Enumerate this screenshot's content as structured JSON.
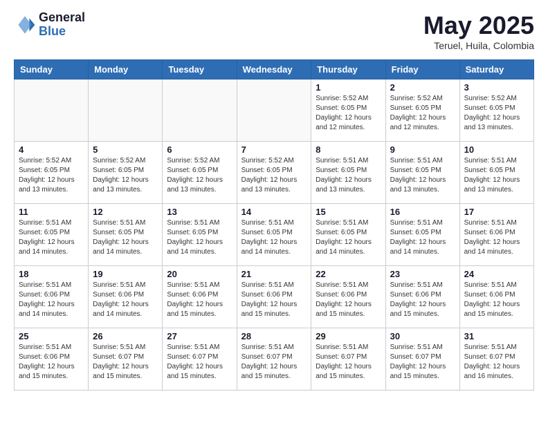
{
  "logo": {
    "general": "General",
    "blue": "Blue"
  },
  "header": {
    "month": "May 2025",
    "location": "Teruel, Huila, Colombia"
  },
  "weekdays": [
    "Sunday",
    "Monday",
    "Tuesday",
    "Wednesday",
    "Thursday",
    "Friday",
    "Saturday"
  ],
  "weeks": [
    [
      {
        "day": "",
        "info": ""
      },
      {
        "day": "",
        "info": ""
      },
      {
        "day": "",
        "info": ""
      },
      {
        "day": "",
        "info": ""
      },
      {
        "day": "1",
        "info": "Sunrise: 5:52 AM\nSunset: 6:05 PM\nDaylight: 12 hours\nand 12 minutes."
      },
      {
        "day": "2",
        "info": "Sunrise: 5:52 AM\nSunset: 6:05 PM\nDaylight: 12 hours\nand 12 minutes."
      },
      {
        "day": "3",
        "info": "Sunrise: 5:52 AM\nSunset: 6:05 PM\nDaylight: 12 hours\nand 13 minutes."
      }
    ],
    [
      {
        "day": "4",
        "info": "Sunrise: 5:52 AM\nSunset: 6:05 PM\nDaylight: 12 hours\nand 13 minutes."
      },
      {
        "day": "5",
        "info": "Sunrise: 5:52 AM\nSunset: 6:05 PM\nDaylight: 12 hours\nand 13 minutes."
      },
      {
        "day": "6",
        "info": "Sunrise: 5:52 AM\nSunset: 6:05 PM\nDaylight: 12 hours\nand 13 minutes."
      },
      {
        "day": "7",
        "info": "Sunrise: 5:52 AM\nSunset: 6:05 PM\nDaylight: 12 hours\nand 13 minutes."
      },
      {
        "day": "8",
        "info": "Sunrise: 5:51 AM\nSunset: 6:05 PM\nDaylight: 12 hours\nand 13 minutes."
      },
      {
        "day": "9",
        "info": "Sunrise: 5:51 AM\nSunset: 6:05 PM\nDaylight: 12 hours\nand 13 minutes."
      },
      {
        "day": "10",
        "info": "Sunrise: 5:51 AM\nSunset: 6:05 PM\nDaylight: 12 hours\nand 13 minutes."
      }
    ],
    [
      {
        "day": "11",
        "info": "Sunrise: 5:51 AM\nSunset: 6:05 PM\nDaylight: 12 hours\nand 14 minutes."
      },
      {
        "day": "12",
        "info": "Sunrise: 5:51 AM\nSunset: 6:05 PM\nDaylight: 12 hours\nand 14 minutes."
      },
      {
        "day": "13",
        "info": "Sunrise: 5:51 AM\nSunset: 6:05 PM\nDaylight: 12 hours\nand 14 minutes."
      },
      {
        "day": "14",
        "info": "Sunrise: 5:51 AM\nSunset: 6:05 PM\nDaylight: 12 hours\nand 14 minutes."
      },
      {
        "day": "15",
        "info": "Sunrise: 5:51 AM\nSunset: 6:05 PM\nDaylight: 12 hours\nand 14 minutes."
      },
      {
        "day": "16",
        "info": "Sunrise: 5:51 AM\nSunset: 6:05 PM\nDaylight: 12 hours\nand 14 minutes."
      },
      {
        "day": "17",
        "info": "Sunrise: 5:51 AM\nSunset: 6:06 PM\nDaylight: 12 hours\nand 14 minutes."
      }
    ],
    [
      {
        "day": "18",
        "info": "Sunrise: 5:51 AM\nSunset: 6:06 PM\nDaylight: 12 hours\nand 14 minutes."
      },
      {
        "day": "19",
        "info": "Sunrise: 5:51 AM\nSunset: 6:06 PM\nDaylight: 12 hours\nand 14 minutes."
      },
      {
        "day": "20",
        "info": "Sunrise: 5:51 AM\nSunset: 6:06 PM\nDaylight: 12 hours\nand 15 minutes."
      },
      {
        "day": "21",
        "info": "Sunrise: 5:51 AM\nSunset: 6:06 PM\nDaylight: 12 hours\nand 15 minutes."
      },
      {
        "day": "22",
        "info": "Sunrise: 5:51 AM\nSunset: 6:06 PM\nDaylight: 12 hours\nand 15 minutes."
      },
      {
        "day": "23",
        "info": "Sunrise: 5:51 AM\nSunset: 6:06 PM\nDaylight: 12 hours\nand 15 minutes."
      },
      {
        "day": "24",
        "info": "Sunrise: 5:51 AM\nSunset: 6:06 PM\nDaylight: 12 hours\nand 15 minutes."
      }
    ],
    [
      {
        "day": "25",
        "info": "Sunrise: 5:51 AM\nSunset: 6:06 PM\nDaylight: 12 hours\nand 15 minutes."
      },
      {
        "day": "26",
        "info": "Sunrise: 5:51 AM\nSunset: 6:07 PM\nDaylight: 12 hours\nand 15 minutes."
      },
      {
        "day": "27",
        "info": "Sunrise: 5:51 AM\nSunset: 6:07 PM\nDaylight: 12 hours\nand 15 minutes."
      },
      {
        "day": "28",
        "info": "Sunrise: 5:51 AM\nSunset: 6:07 PM\nDaylight: 12 hours\nand 15 minutes."
      },
      {
        "day": "29",
        "info": "Sunrise: 5:51 AM\nSunset: 6:07 PM\nDaylight: 12 hours\nand 15 minutes."
      },
      {
        "day": "30",
        "info": "Sunrise: 5:51 AM\nSunset: 6:07 PM\nDaylight: 12 hours\nand 15 minutes."
      },
      {
        "day": "31",
        "info": "Sunrise: 5:51 AM\nSunset: 6:07 PM\nDaylight: 12 hours\nand 16 minutes."
      }
    ]
  ]
}
